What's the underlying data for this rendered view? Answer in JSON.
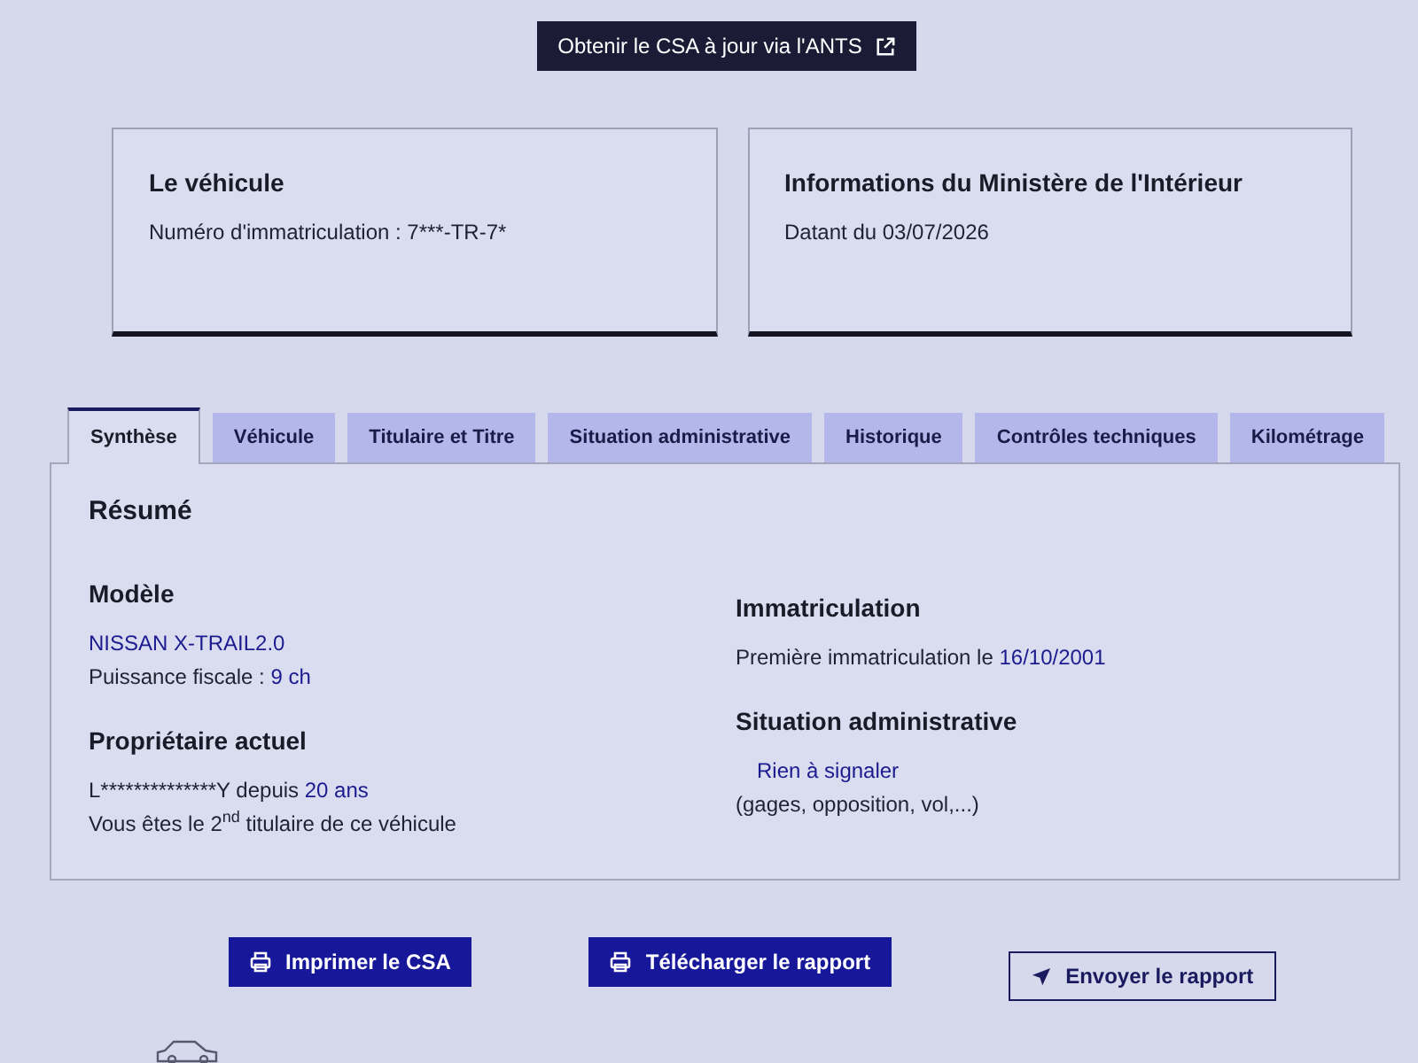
{
  "top_link": {
    "label": "Obtenir le CSA à jour via l'ANTS"
  },
  "cards": [
    {
      "title": "Le véhicule",
      "text": "Numéro d'immatriculation : 7***-TR-7*"
    },
    {
      "title": "Informations du Ministère de l'Intérieur",
      "text": "Datant du 03/07/2026"
    }
  ],
  "tabs": [
    {
      "label": "Synthèse",
      "selected": true
    },
    {
      "label": "Véhicule",
      "selected": false
    },
    {
      "label": "Titulaire et Titre",
      "selected": false
    },
    {
      "label": "Situation administrative",
      "selected": false
    },
    {
      "label": "Historique",
      "selected": false
    },
    {
      "label": "Contrôles techniques",
      "selected": false
    },
    {
      "label": "Kilométrage",
      "selected": false
    }
  ],
  "summary": {
    "title": "Résumé",
    "columns": [
      [
        {
          "heading": "Modèle",
          "lines": [
            {
              "kind": "text",
              "parts": [
                {
                  "kind": "value",
                  "text": "NISSAN X-TRAIL2.0"
                }
              ]
            },
            {
              "kind": "text",
              "parts": [
                {
                  "kind": "text",
                  "text": "Puissance fiscale : "
                },
                {
                  "kind": "value",
                  "text": "9 ch"
                }
              ]
            }
          ]
        },
        {
          "heading": "Propriétaire actuel",
          "lines": [
            {
              "kind": "text",
              "parts": [
                {
                  "kind": "text",
                  "text": "L**************Y depuis "
                },
                {
                  "kind": "value",
                  "text": "20 ans"
                }
              ]
            },
            {
              "kind": "text",
              "parts": [
                {
                  "kind": "text",
                  "text": "Vous êtes le 2"
                },
                {
                  "kind": "sup",
                  "text": "nd"
                },
                {
                  "kind": "text",
                  "text": " titulaire de ce véhicule"
                }
              ]
            }
          ]
        }
      ],
      [
        {
          "heading": "Immatriculation",
          "lines": [
            {
              "kind": "text",
              "parts": [
                {
                  "kind": "text",
                  "text": "Première immatriculation le "
                },
                {
                  "kind": "value",
                  "text": "16/10/2001"
                }
              ]
            }
          ]
        },
        {
          "heading": "Situation administrative",
          "lines": [
            {
              "kind": "status",
              "parts": [
                {
                  "kind": "value",
                  "text": "Rien à signaler"
                }
              ]
            },
            {
              "kind": "text",
              "parts": [
                {
                  "kind": "text",
                  "text": "(gages, opposition, vol,...)"
                }
              ]
            }
          ]
        }
      ]
    ]
  },
  "actions": [
    {
      "label": "Imprimer le CSA",
      "kind": "print"
    },
    {
      "label": "Télécharger le rapport",
      "kind": "print"
    },
    {
      "label": "Envoyer le rapport",
      "kind": "send"
    }
  ]
}
